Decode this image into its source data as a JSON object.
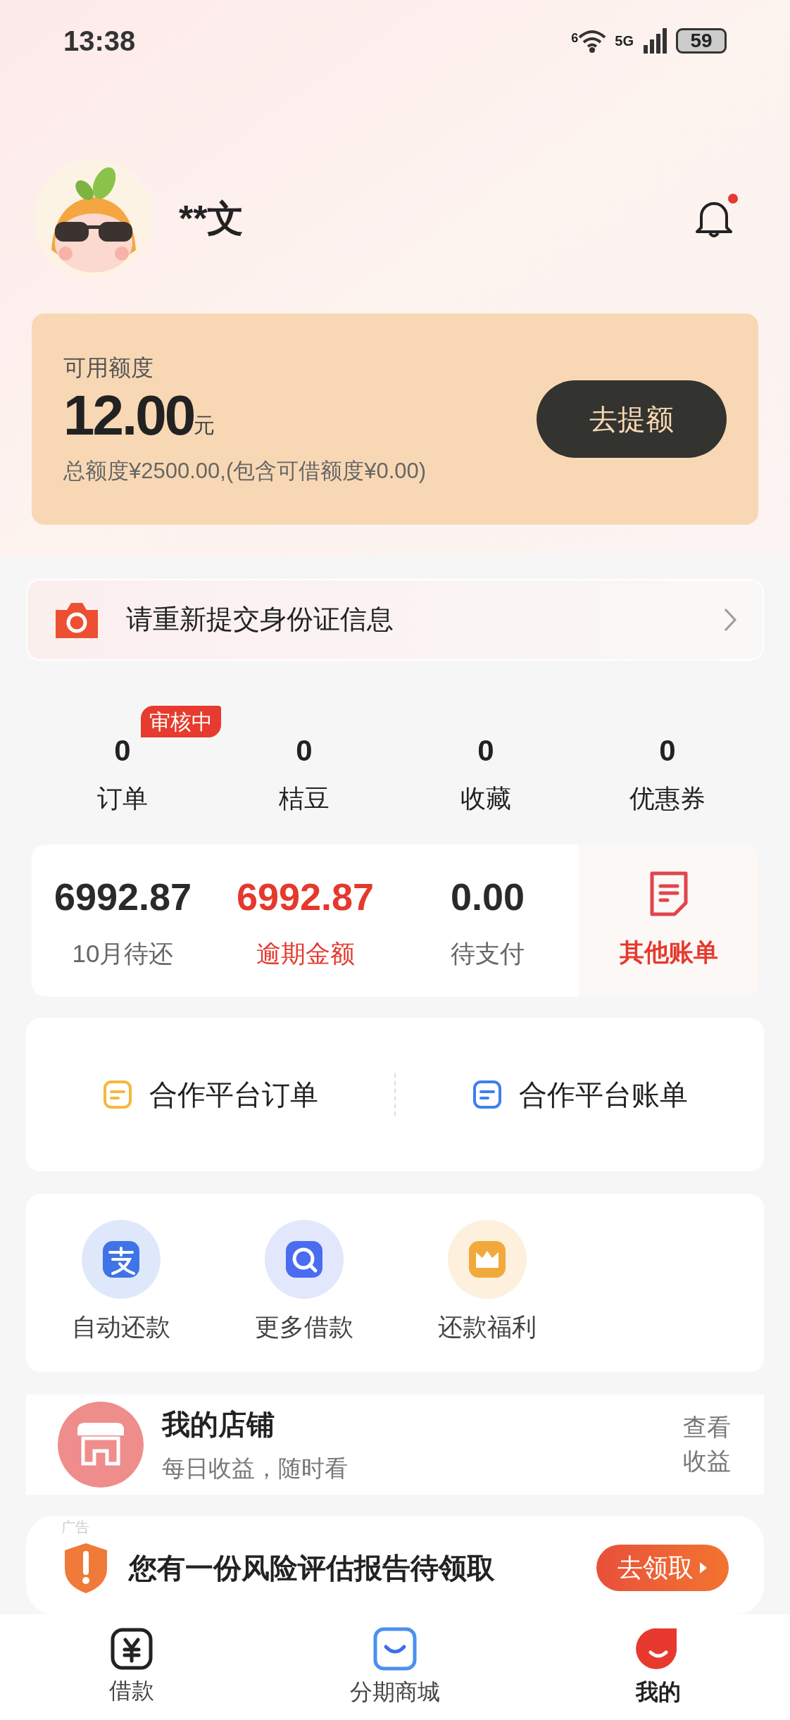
{
  "status_bar": {
    "time": "13:38",
    "battery": "59",
    "wifi_badge": "6",
    "network": "5G"
  },
  "profile": {
    "name": "**文",
    "notification_dot": true
  },
  "credit": {
    "label": "可用额度",
    "amount": "12.00",
    "unit": "元",
    "total": "总额度¥2500.00,(包含可借额度¥0.00)",
    "button": "去提额"
  },
  "notice": {
    "text": "请重新提交身份证信息"
  },
  "stats": [
    {
      "value": "0",
      "label": "订单",
      "badge": "审核中"
    },
    {
      "value": "0",
      "label": "桔豆"
    },
    {
      "value": "0",
      "label": "收藏"
    },
    {
      "value": "0",
      "label": "优惠券"
    }
  ],
  "bills": [
    {
      "value": "6992.87",
      "label": "10月待还",
      "alert": false
    },
    {
      "value": "6992.87",
      "label": "逾期金额",
      "alert": true
    },
    {
      "value": "0.00",
      "label": "待支付",
      "alert": false
    }
  ],
  "other_bills": {
    "label": "其他账单"
  },
  "partner_links": [
    {
      "label": "合作平台订单",
      "color": "#f5b73b"
    },
    {
      "label": "合作平台账单",
      "color": "#3d7ff0"
    }
  ],
  "shortcuts": [
    {
      "label": "自动还款",
      "kind": "pay"
    },
    {
      "label": "更多借款",
      "kind": "search"
    },
    {
      "label": "还款福利",
      "kind": "crown"
    }
  ],
  "store": {
    "title": "我的店铺",
    "subtitle": "每日收益，随时看",
    "link": "查看收益"
  },
  "ad": {
    "tag": "广告",
    "text": "您有一份风险评估报告待领取",
    "button": "去领取"
  },
  "tab_bar": [
    {
      "label": "借款",
      "kind": "loan",
      "selected": false
    },
    {
      "label": "分期商城",
      "kind": "mall",
      "selected": false
    },
    {
      "label": "我的",
      "kind": "me",
      "selected": true
    }
  ]
}
